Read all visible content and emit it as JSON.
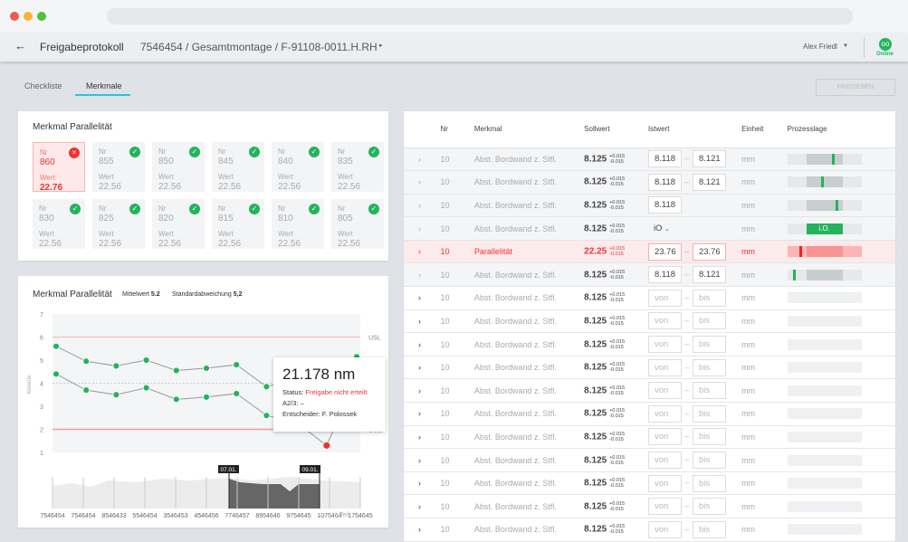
{
  "header": {
    "title": "Freigabeprotokoll",
    "breadcrumb": "7546454 / Gesamtmontage / F-91108-0011.H.RH",
    "user": "Alex Friedl",
    "status": "Online"
  },
  "tabs": [
    {
      "label": "Checkliste"
    },
    {
      "label": "Merkmale"
    }
  ],
  "release_button": "FREIGEBEN",
  "tiles_card": {
    "title": "Merkmal Parallelität",
    "nr_label": "Nr",
    "wert_label": "Wert",
    "tiles": [
      {
        "nr": "860",
        "wert": "22.76",
        "ok": false
      },
      {
        "nr": "855",
        "wert": "22.56",
        "ok": true
      },
      {
        "nr": "850",
        "wert": "22.56",
        "ok": true
      },
      {
        "nr": "845",
        "wert": "22.56",
        "ok": true
      },
      {
        "nr": "840",
        "wert": "22.56",
        "ok": true
      },
      {
        "nr": "835",
        "wert": "22.56",
        "ok": true
      },
      {
        "nr": "830",
        "wert": "22.56",
        "ok": true
      },
      {
        "nr": "825",
        "wert": "22.56",
        "ok": true
      },
      {
        "nr": "820",
        "wert": "22.56",
        "ok": true
      },
      {
        "nr": "815",
        "wert": "22.56",
        "ok": true
      },
      {
        "nr": "810",
        "wert": "22.56",
        "ok": true
      },
      {
        "nr": "805",
        "wert": "22.56",
        "ok": true
      }
    ]
  },
  "chart_card": {
    "title": "Merkmal Parallelität",
    "mean_label": "Mittelwert",
    "mean": "5.2",
    "std_label": "Standardabweichung",
    "std": "5,2",
    "tooltip": {
      "value": "21.178 nm",
      "status_label": "Status:",
      "status": "Freigabe nicht erteilt",
      "a23": "A2/3: –",
      "decider": "Entscheider: F. Polossek"
    },
    "range": {
      "start": "07.01.",
      "end": "09.01."
    }
  },
  "chart_data": {
    "type": "line",
    "ylabel": "Istwerte",
    "xlabel": "Teil",
    "ylim": [
      1,
      7
    ],
    "yticks": [
      "1",
      "2",
      "3",
      "4",
      "5",
      "6",
      "7"
    ],
    "categories": [
      "7546454",
      "7546454",
      "8546433",
      "5546454",
      "3546453",
      "4546456",
      "7746457",
      "8954646",
      "9754645",
      "1075464",
      "1754645"
    ],
    "usl": 6,
    "ucl": 2,
    "usl_label": "USL",
    "ucl_label": "UCL",
    "mean_line": 4,
    "series": [
      {
        "name": "upper",
        "values": [
          5.6,
          4.95,
          4.75,
          5.0,
          4.55,
          4.65,
          4.8,
          3.85,
          4.2,
          4.7,
          5.15
        ]
      },
      {
        "name": "lower",
        "values": [
          4.4,
          3.7,
          3.5,
          3.8,
          3.3,
          3.4,
          3.55,
          2.6,
          2.3,
          1.3,
          4.2
        ]
      }
    ],
    "failed_point": {
      "series": "lower",
      "index": 9
    }
  },
  "table": {
    "headers": [
      "Nr",
      "Merkmal",
      "Sollwert",
      "Istwert",
      "Einheit",
      "Prozesslage"
    ],
    "rows": [
      {
        "state": "done",
        "nr": "10",
        "name": "Abst. Bordwand z. Stfl.",
        "soll": "8.125",
        "tp": "+0.015",
        "tm": "-0.015",
        "von": "8.118",
        "bis": "8.121",
        "unit": "mm",
        "mk": 0.6
      },
      {
        "state": "done",
        "nr": "10",
        "name": "Abst. Bordwand z. Stfl.",
        "soll": "8.125",
        "tp": "+0.015",
        "tm": "-0.015",
        "von": "8.118",
        "bis": "8.121",
        "unit": "mm",
        "mk": 0.45
      },
      {
        "state": "done",
        "nr": "10",
        "name": "Abst. Bordwand z. Stfl.",
        "soll": "8.125",
        "tp": "+0.015",
        "tm": "-0.015",
        "von": "8.118",
        "unit": "mm",
        "mk": 0.65
      },
      {
        "state": "done",
        "nr": "10",
        "name": "Abst. Bordwand z. Stfl.",
        "soll": "8.125",
        "tp": "+0.015",
        "tm": "-0.015",
        "select": "iO",
        "unit": "mm",
        "io": "i.O."
      },
      {
        "state": "err",
        "nr": "10",
        "name": "Parallelität",
        "soll": "22.25",
        "tp": "+0.015",
        "tm": "-0.015",
        "von": "23.76",
        "bis": "23.76",
        "unit": "mm",
        "mk": 0.16
      },
      {
        "state": "done",
        "nr": "10",
        "name": "Abst. Bordwand z. Stfl.",
        "soll": "8.125",
        "tp": "+0.015",
        "tm": "-0.015",
        "von": "8.118",
        "bis": "8.121",
        "unit": "mm",
        "mk": 0.08
      }
    ],
    "open_row": {
      "nr": "10",
      "name": "Abst. Bordwand z. Stfl.",
      "soll": "8.125",
      "tp": "+0.015",
      "tm": "-0.015",
      "von": "von",
      "bis": "bis",
      "unit": "mm"
    },
    "open_count": 11
  }
}
